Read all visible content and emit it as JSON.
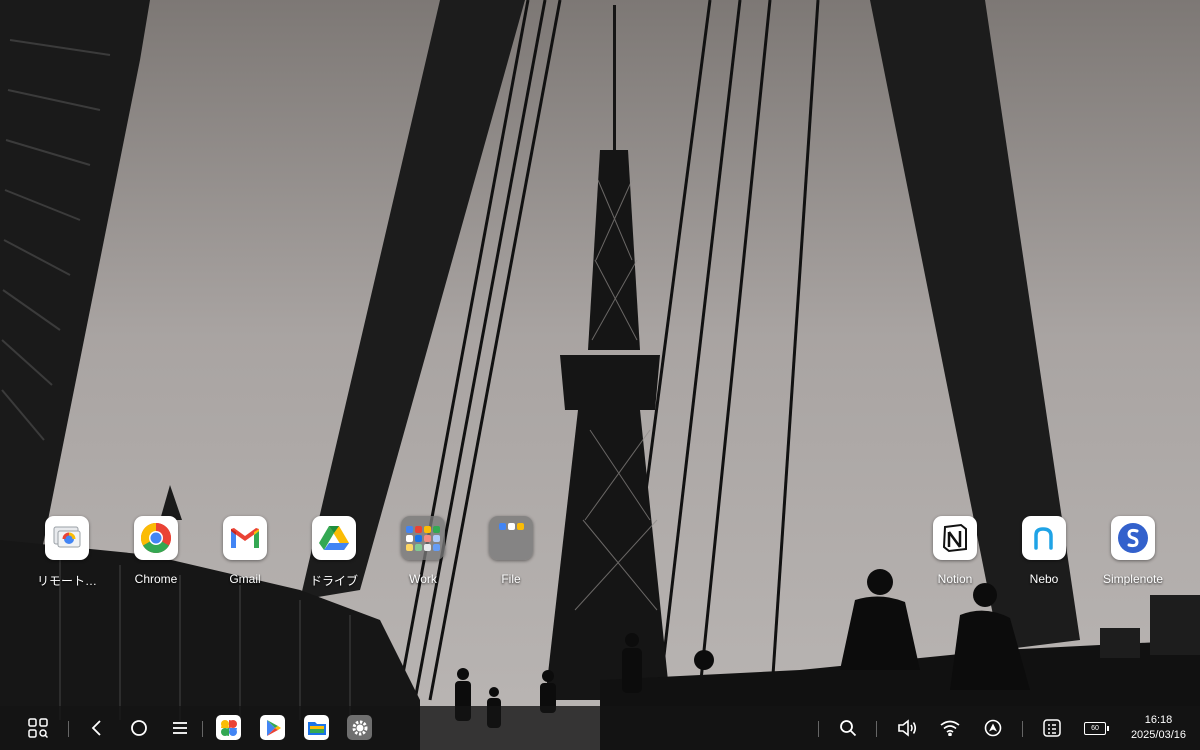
{
  "wallpaper": {
    "description_icon": "bridge-and-tv-tower-photo"
  },
  "home_apps": [
    {
      "label": "リモート…",
      "icon": "remote-desktop-icon"
    },
    {
      "label": "Chrome",
      "icon": "chrome-icon"
    },
    {
      "label": "Gmail",
      "icon": "gmail-icon"
    },
    {
      "label": "ドライブ",
      "icon": "drive-icon"
    },
    {
      "label": "Work",
      "icon": "folder-icon"
    },
    {
      "label": "File",
      "icon": "folder-icon"
    },
    {
      "label": "Notion",
      "icon": "notion-icon"
    },
    {
      "label": "Nebo",
      "icon": "nebo-icon"
    },
    {
      "label": "Simplenote",
      "icon": "simplenote-icon"
    }
  ],
  "taskbar": {
    "nav": [
      "app-drawer-icon",
      "back-icon",
      "home-icon",
      "recents-icon"
    ],
    "pinned": [
      "photos-icon",
      "play-store-icon",
      "files-icon",
      "settings-icon"
    ],
    "system": [
      "search-icon",
      "volume-icon",
      "wifi-icon",
      "location-icon",
      "quick-settings-icon"
    ],
    "battery": "60",
    "time": "16:18",
    "date": "2025/03/16"
  },
  "colors": {
    "taskbar_bg": "#141414",
    "chrome_red": "#EA4335",
    "chrome_green": "#34A853",
    "chrome_yellow": "#FBBC05",
    "chrome_blue": "#4285F4",
    "simplenote_blue": "#3361CC"
  }
}
